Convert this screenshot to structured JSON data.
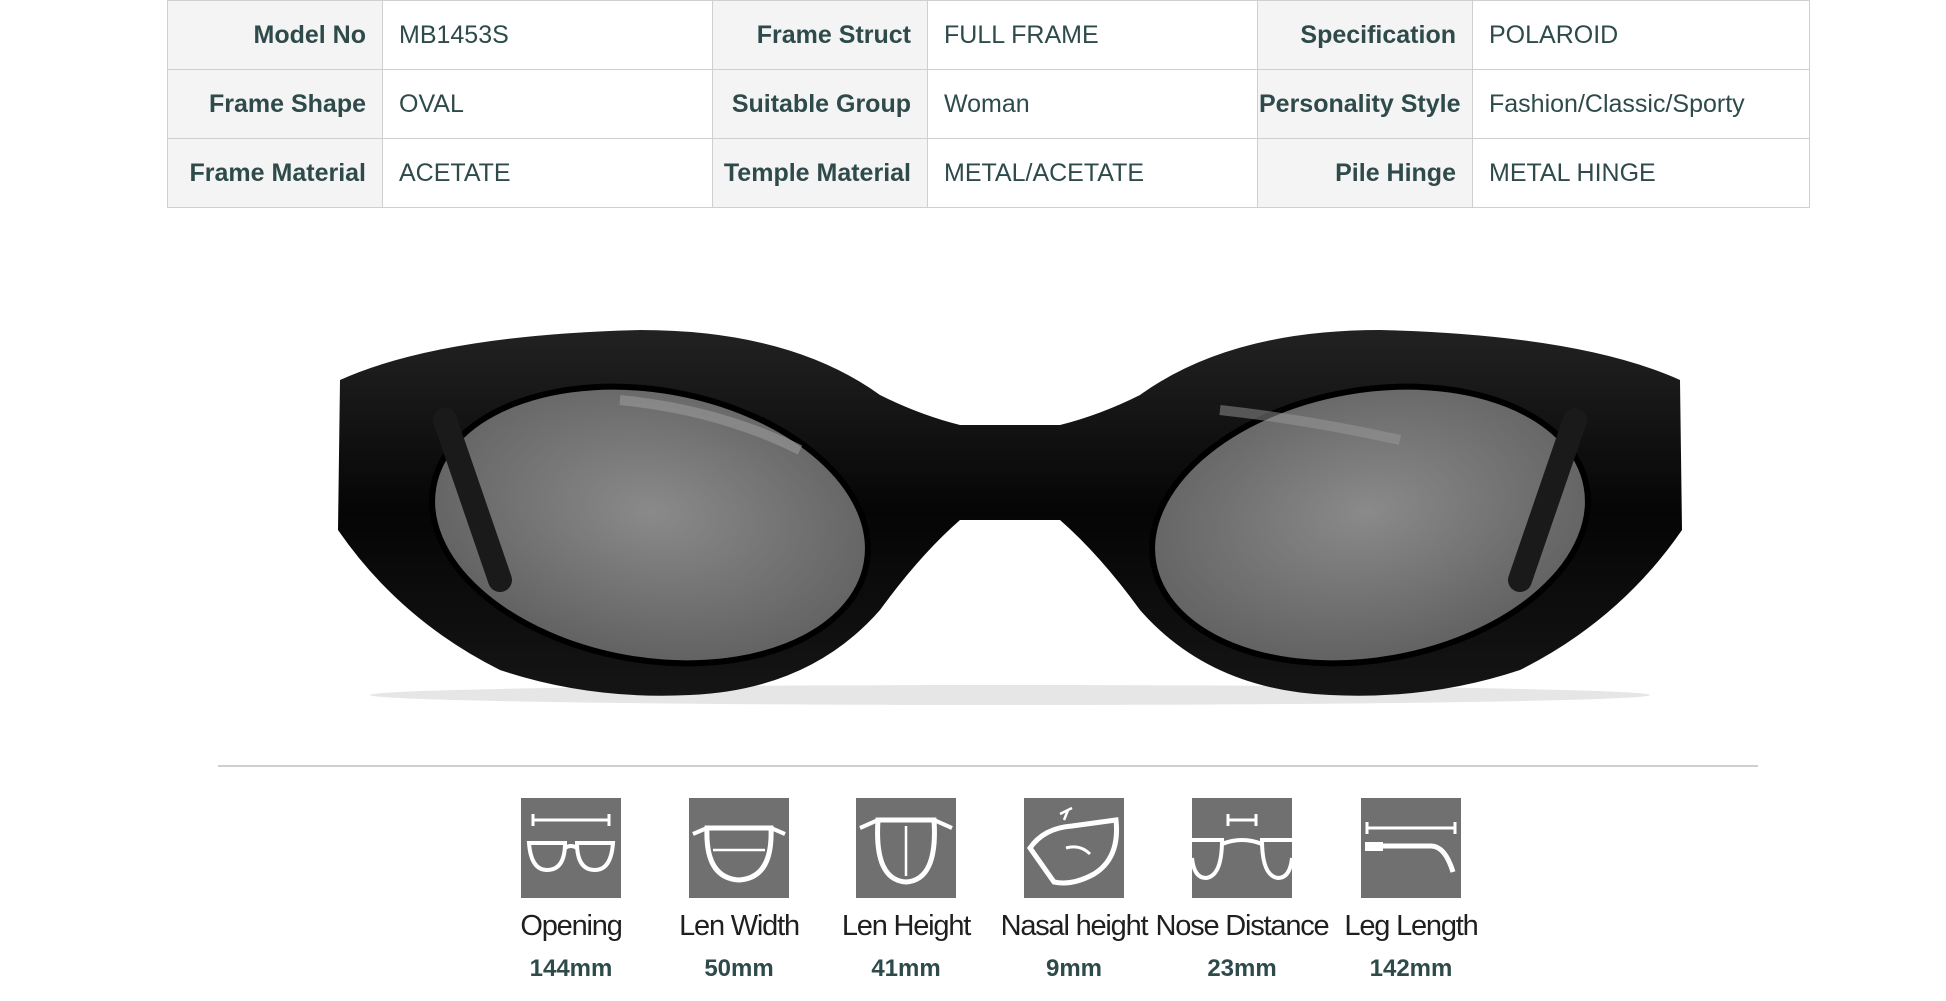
{
  "specs": {
    "rows": [
      [
        {
          "label": "Model No",
          "value": "MB1453S"
        },
        {
          "label": "Frame Struct",
          "value": "FULL FRAME"
        },
        {
          "label": "Specification",
          "value": "POLAROID"
        }
      ],
      [
        {
          "label": "Frame Shape",
          "value": "OVAL"
        },
        {
          "label": "Suitable Group",
          "value": "Woman"
        },
        {
          "label": "Personality Style",
          "value": "Fashion/Classic/Sporty"
        }
      ],
      [
        {
          "label": "Frame Material",
          "value": "ACETATE"
        },
        {
          "label": "Temple Material",
          "value": "METAL/ACETATE"
        },
        {
          "label": "Pile Hinge",
          "value": "METAL HINGE"
        }
      ]
    ]
  },
  "product_image": {
    "icon": "oval-black-sunglasses-photo",
    "frame_color": "#0d0d0d",
    "lens_color": "#6b6b6b"
  },
  "dimensions": [
    {
      "label": "Opening",
      "value": "144mm",
      "icon": "opening-width-icon"
    },
    {
      "label": "Len Width",
      "value": "50mm",
      "icon": "lens-width-icon"
    },
    {
      "label": "Len Height",
      "value": "41mm",
      "icon": "lens-height-icon"
    },
    {
      "label": "Nasal height",
      "value": "9mm",
      "icon": "nasal-height-icon"
    },
    {
      "label": "Nose Distance",
      "value": "23mm",
      "icon": "nose-distance-icon"
    },
    {
      "label": "Leg Length",
      "value": "142mm",
      "icon": "leg-length-icon"
    }
  ],
  "colors": {
    "label_text": "#2e4a4a",
    "label_bg": "#f4f4f4",
    "border": "#cfcfcf",
    "icon_bg": "#707070"
  }
}
